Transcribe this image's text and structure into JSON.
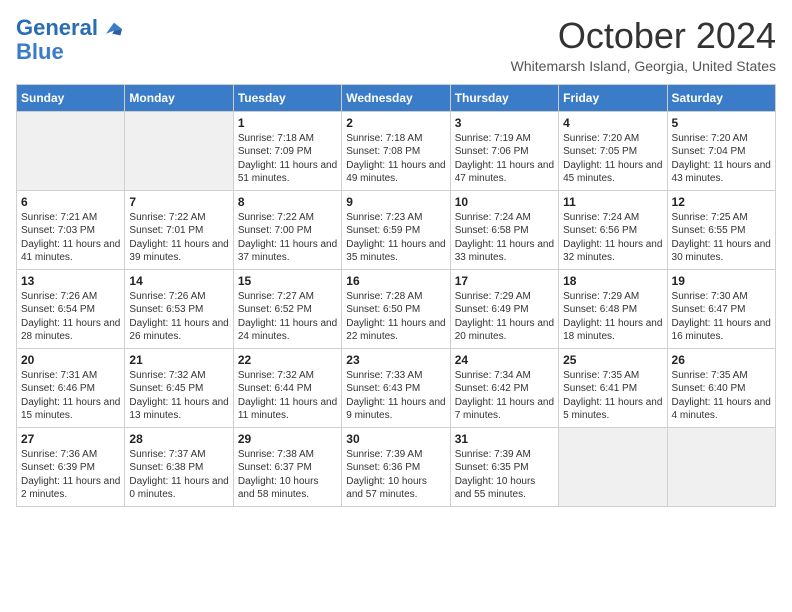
{
  "header": {
    "logo_line1": "General",
    "logo_line2": "Blue",
    "month_title": "October 2024",
    "location": "Whitemarsh Island, Georgia, United States"
  },
  "weekdays": [
    "Sunday",
    "Monday",
    "Tuesday",
    "Wednesday",
    "Thursday",
    "Friday",
    "Saturday"
  ],
  "weeks": [
    [
      {
        "day": "",
        "empty": true
      },
      {
        "day": "",
        "empty": true
      },
      {
        "day": "1",
        "sunrise": "7:18 AM",
        "sunset": "7:09 PM",
        "daylight": "11 hours and 51 minutes."
      },
      {
        "day": "2",
        "sunrise": "7:18 AM",
        "sunset": "7:08 PM",
        "daylight": "11 hours and 49 minutes."
      },
      {
        "day": "3",
        "sunrise": "7:19 AM",
        "sunset": "7:06 PM",
        "daylight": "11 hours and 47 minutes."
      },
      {
        "day": "4",
        "sunrise": "7:20 AM",
        "sunset": "7:05 PM",
        "daylight": "11 hours and 45 minutes."
      },
      {
        "day": "5",
        "sunrise": "7:20 AM",
        "sunset": "7:04 PM",
        "daylight": "11 hours and 43 minutes."
      }
    ],
    [
      {
        "day": "6",
        "sunrise": "7:21 AM",
        "sunset": "7:03 PM",
        "daylight": "11 hours and 41 minutes."
      },
      {
        "day": "7",
        "sunrise": "7:22 AM",
        "sunset": "7:01 PM",
        "daylight": "11 hours and 39 minutes."
      },
      {
        "day": "8",
        "sunrise": "7:22 AM",
        "sunset": "7:00 PM",
        "daylight": "11 hours and 37 minutes."
      },
      {
        "day": "9",
        "sunrise": "7:23 AM",
        "sunset": "6:59 PM",
        "daylight": "11 hours and 35 minutes."
      },
      {
        "day": "10",
        "sunrise": "7:24 AM",
        "sunset": "6:58 PM",
        "daylight": "11 hours and 33 minutes."
      },
      {
        "day": "11",
        "sunrise": "7:24 AM",
        "sunset": "6:56 PM",
        "daylight": "11 hours and 32 minutes."
      },
      {
        "day": "12",
        "sunrise": "7:25 AM",
        "sunset": "6:55 PM",
        "daylight": "11 hours and 30 minutes."
      }
    ],
    [
      {
        "day": "13",
        "sunrise": "7:26 AM",
        "sunset": "6:54 PM",
        "daylight": "11 hours and 28 minutes."
      },
      {
        "day": "14",
        "sunrise": "7:26 AM",
        "sunset": "6:53 PM",
        "daylight": "11 hours and 26 minutes."
      },
      {
        "day": "15",
        "sunrise": "7:27 AM",
        "sunset": "6:52 PM",
        "daylight": "11 hours and 24 minutes."
      },
      {
        "day": "16",
        "sunrise": "7:28 AM",
        "sunset": "6:50 PM",
        "daylight": "11 hours and 22 minutes."
      },
      {
        "day": "17",
        "sunrise": "7:29 AM",
        "sunset": "6:49 PM",
        "daylight": "11 hours and 20 minutes."
      },
      {
        "day": "18",
        "sunrise": "7:29 AM",
        "sunset": "6:48 PM",
        "daylight": "11 hours and 18 minutes."
      },
      {
        "day": "19",
        "sunrise": "7:30 AM",
        "sunset": "6:47 PM",
        "daylight": "11 hours and 16 minutes."
      }
    ],
    [
      {
        "day": "20",
        "sunrise": "7:31 AM",
        "sunset": "6:46 PM",
        "daylight": "11 hours and 15 minutes."
      },
      {
        "day": "21",
        "sunrise": "7:32 AM",
        "sunset": "6:45 PM",
        "daylight": "11 hours and 13 minutes."
      },
      {
        "day": "22",
        "sunrise": "7:32 AM",
        "sunset": "6:44 PM",
        "daylight": "11 hours and 11 minutes."
      },
      {
        "day": "23",
        "sunrise": "7:33 AM",
        "sunset": "6:43 PM",
        "daylight": "11 hours and 9 minutes."
      },
      {
        "day": "24",
        "sunrise": "7:34 AM",
        "sunset": "6:42 PM",
        "daylight": "11 hours and 7 minutes."
      },
      {
        "day": "25",
        "sunrise": "7:35 AM",
        "sunset": "6:41 PM",
        "daylight": "11 hours and 5 minutes."
      },
      {
        "day": "26",
        "sunrise": "7:35 AM",
        "sunset": "6:40 PM",
        "daylight": "11 hours and 4 minutes."
      }
    ],
    [
      {
        "day": "27",
        "sunrise": "7:36 AM",
        "sunset": "6:39 PM",
        "daylight": "11 hours and 2 minutes."
      },
      {
        "day": "28",
        "sunrise": "7:37 AM",
        "sunset": "6:38 PM",
        "daylight": "11 hours and 0 minutes."
      },
      {
        "day": "29",
        "sunrise": "7:38 AM",
        "sunset": "6:37 PM",
        "daylight": "10 hours and 58 minutes."
      },
      {
        "day": "30",
        "sunrise": "7:39 AM",
        "sunset": "6:36 PM",
        "daylight": "10 hours and 57 minutes."
      },
      {
        "day": "31",
        "sunrise": "7:39 AM",
        "sunset": "6:35 PM",
        "daylight": "10 hours and 55 minutes."
      },
      {
        "day": "",
        "empty": true
      },
      {
        "day": "",
        "empty": true
      }
    ]
  ]
}
